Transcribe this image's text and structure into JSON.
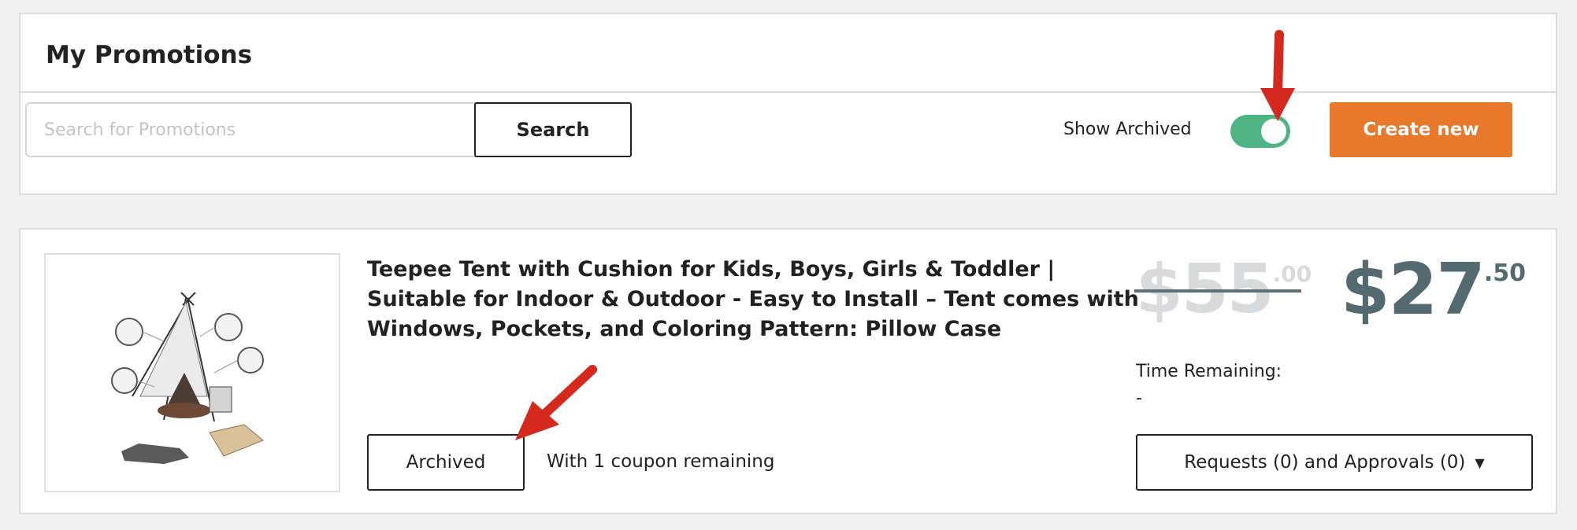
{
  "header": {
    "title": "My Promotions"
  },
  "toolbar": {
    "search_placeholder": "Search for Promotions",
    "search_value": "",
    "search_button_label": "Search",
    "show_archived_label": "Show Archived",
    "show_archived_on": true,
    "create_button_label": "Create new"
  },
  "promotion": {
    "title": "Teepee Tent with Cushion for Kids, Boys, Girls & Toddler | Suitable for Indoor & Outdoor - Easy to Install – Tent comes with Windows, Pockets, and Coloring Pattern: Pillow Case",
    "image_icon": "teepee-tent-product-image",
    "original_price_main": "$55",
    "original_price_cents": ".00",
    "sale_price_main": "$27",
    "sale_price_cents": ".50",
    "time_remaining_label": "Time Remaining:",
    "time_remaining_value": "-",
    "status_label": "Archived",
    "coupon_text": "With 1 coupon remaining",
    "requests_label": "Requests (0) and Approvals (0)"
  },
  "colors": {
    "accent_orange": "#e8782a",
    "toggle_green": "#4fb483",
    "price_gray": "#536a70",
    "strike_price_gray": "#d8dadb",
    "annotation_red": "#d6291d"
  }
}
